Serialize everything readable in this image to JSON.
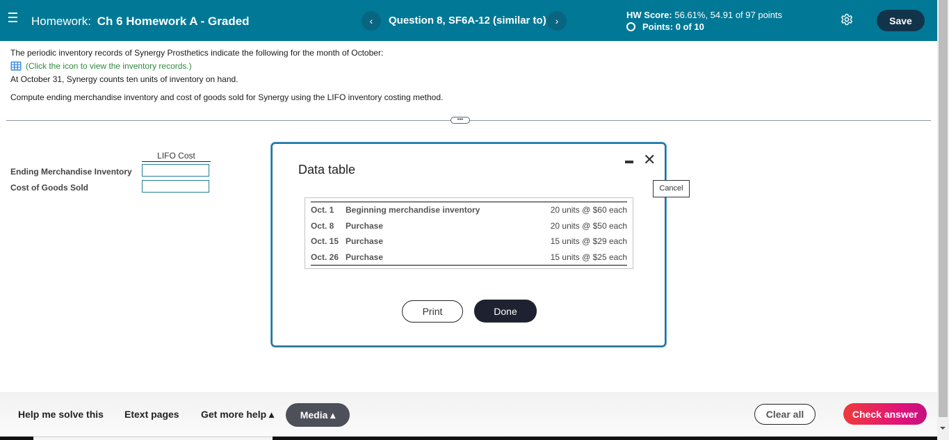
{
  "header": {
    "homework_prefix": "Homework:",
    "homework_title": "Ch 6 Homework A - Graded",
    "question_label": "Question 8, SF6A-12 (similar to)",
    "prev_icon": "‹",
    "next_icon": "›",
    "hw_score_label": "HW Score:",
    "hw_score_value": "56.61%, 54.91 of 97 points",
    "points_label": "Points:",
    "points_value": "0 of 10",
    "save_label": "Save"
  },
  "question": {
    "line1": "The periodic inventory records of Synergy Prosthetics indicate the following for the month of October:",
    "link_text": "(Click the icon to view the inventory records.)",
    "line3": "At October 31, Synergy counts ten units of inventory on hand.",
    "line4": "Compute ending merchandise inventory and cost of goods sold for Synergy using the LIFO inventory costing method.",
    "divider_handle": "•••"
  },
  "answer_table": {
    "column_header": "LIFO Cost",
    "rows": [
      {
        "label": "Ending Merchandise Inventory",
        "value": ""
      },
      {
        "label": "Cost of Goods Sold",
        "value": ""
      }
    ]
  },
  "modal": {
    "title": "Data table",
    "close_icon": "✕",
    "rows": [
      {
        "date": "Oct. 1",
        "description": "Beginning merchandise inventory",
        "detail": "20 units @ $60 each"
      },
      {
        "date": "Oct. 8",
        "description": "Purchase",
        "detail": "20 units @ $50 each"
      },
      {
        "date": "Oct. 15",
        "description": "Purchase",
        "detail": "15 units @ $29 each"
      },
      {
        "date": "Oct. 26",
        "description": "Purchase",
        "detail": "15 units @ $25 each"
      }
    ],
    "print_label": "Print",
    "done_label": "Done",
    "tooltip": "Cancel"
  },
  "footer": {
    "help_solve": "Help me solve this",
    "etext": "Etext pages",
    "more_help": "Get more help ▴",
    "media": "Media ▴",
    "clear_all": "Clear all",
    "check_answer": "Check answer"
  }
}
